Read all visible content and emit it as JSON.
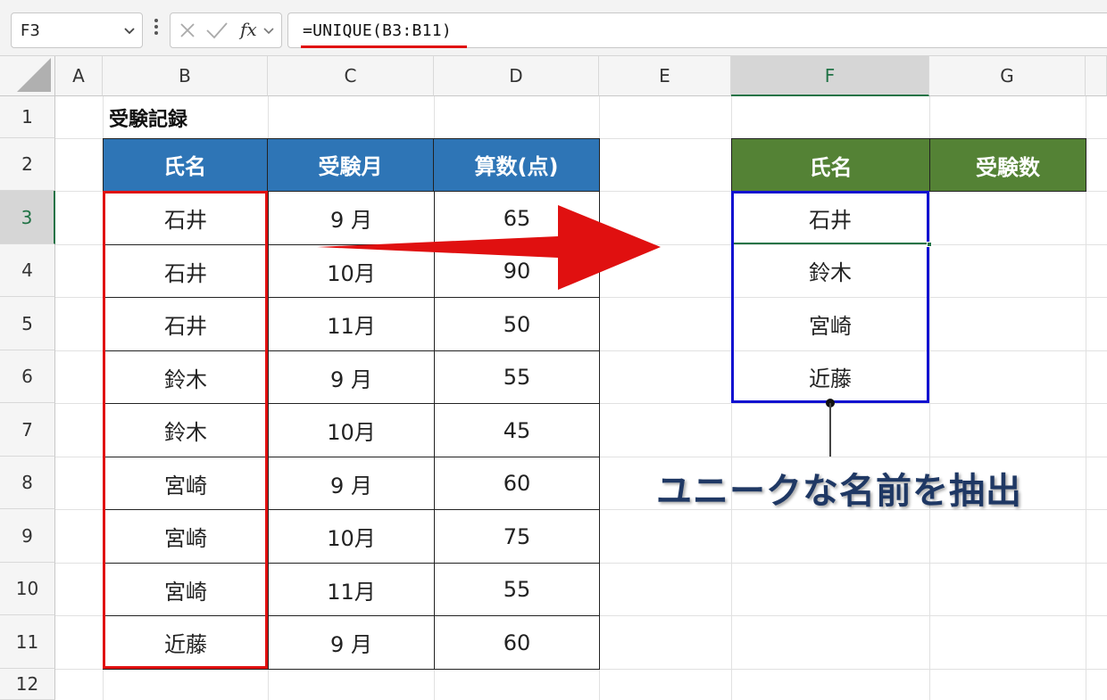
{
  "formula_bar": {
    "name_box": "F3",
    "formula": "=UNIQUE(B3:B11)",
    "fx_label": "fx"
  },
  "columns": [
    "A",
    "B",
    "C",
    "D",
    "E",
    "F",
    "G"
  ],
  "rows": [
    "1",
    "2",
    "3",
    "4",
    "5",
    "6",
    "7",
    "8",
    "9",
    "10",
    "11",
    "12"
  ],
  "selected_cell": {
    "column": "F",
    "row": "3"
  },
  "sheet": {
    "title": "受験記録",
    "table_headers": [
      "氏名",
      "受験月",
      "算数(点)"
    ],
    "table_rows": [
      [
        "石井",
        "9 月",
        "65"
      ],
      [
        "石井",
        "10月",
        "90"
      ],
      [
        "石井",
        "11月",
        "50"
      ],
      [
        "鈴木",
        "9 月",
        "55"
      ],
      [
        "鈴木",
        "10月",
        "45"
      ],
      [
        "宮崎",
        "9 月",
        "60"
      ],
      [
        "宮崎",
        "10月",
        "75"
      ],
      [
        "宮崎",
        "11月",
        "55"
      ],
      [
        "近藤",
        "9 月",
        "60"
      ]
    ],
    "result_headers": [
      "氏名",
      "受験数"
    ],
    "result_names": [
      "石井",
      "鈴木",
      "宮崎",
      "近藤"
    ]
  },
  "annotation": "ユニークな名前を抽出",
  "colors": {
    "table_header": "#2e75b6",
    "result_header": "#548235",
    "highlight_red": "#e01010",
    "highlight_blue": "#1010d0",
    "selection_green": "#217346",
    "annotation_text": "#1f3864"
  },
  "icons": [
    "chevron-down-icon",
    "cancel-x-icon",
    "confirm-check-icon",
    "chevron-down-icon",
    "red-arrow-icon"
  ]
}
